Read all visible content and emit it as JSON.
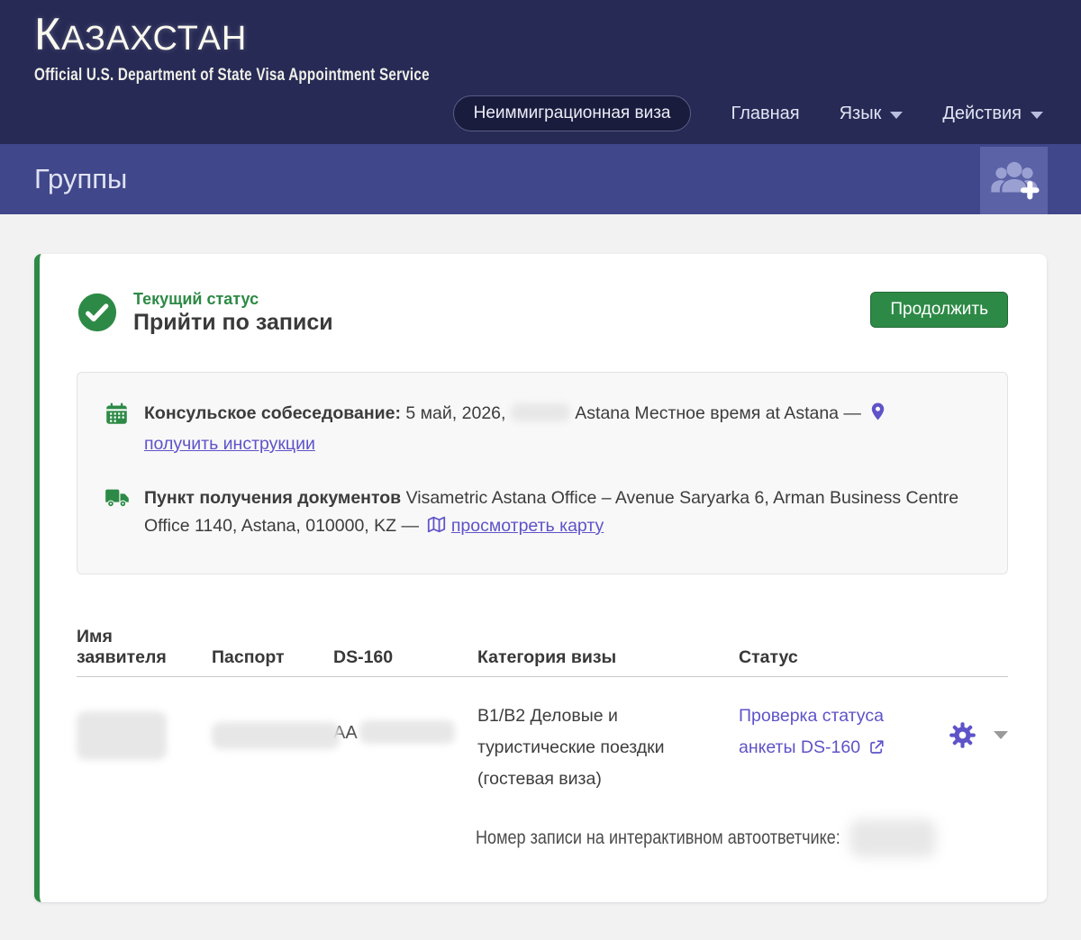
{
  "header": {
    "brand_initial": "К",
    "brand_rest": "АЗАХСТАН",
    "subtitle": "Official U.S. Department of State Visa Appointment Service",
    "nav": {
      "active_pill": "Неиммиграционная виза",
      "home": "Главная",
      "language": "Язык",
      "actions": "Действия"
    }
  },
  "page_bar": {
    "title": "Группы"
  },
  "status_card": {
    "status_label": "Текущий статус",
    "status_value": "Прийти по записи",
    "continue_button": "Продолжить",
    "appointment": {
      "label": "Консульское собеседование:",
      "date": "5 май, 2026,",
      "location_text": "Astana Местное время at Astana —",
      "instructions_link": "получить инструкции"
    },
    "document_pickup": {
      "label": "Пункт получения документов",
      "address": "Visametric Astana Office – Avenue Saryarka 6, Arman Business Centre Office 1140, Astana, 010000, KZ —",
      "map_link": "просмотреть карту"
    }
  },
  "applicants_table": {
    "columns": [
      "Имя заявителя",
      "Паспорт",
      "DS-160",
      "Категория визы",
      "Статус"
    ],
    "rows": [
      {
        "ds160_prefix": "AA",
        "visa_category": "B1/B2 Деловые и туристические поездки (гостевая виза)",
        "status_link": "Проверка статуса анкеты DS-160"
      }
    ]
  },
  "footer_note": {
    "label": "Номер записи на интерактивном автоответчике:"
  },
  "colors": {
    "header_navy": "#272a54",
    "bar_purple": "#40478a",
    "green": "#2d8a46",
    "link_purple": "#5e53c8",
    "page_background": "#f2f2f3"
  }
}
